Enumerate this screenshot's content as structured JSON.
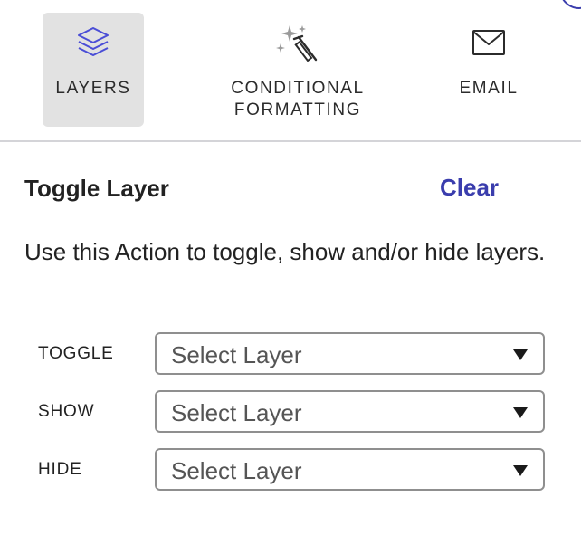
{
  "tabs": [
    {
      "label": "LAYERS",
      "icon": "layers-icon",
      "active": true
    },
    {
      "label_line1": "CONDITIONAL",
      "label_line2": "FORMATTING",
      "icon": "magic-wand-sparkles-icon",
      "active": false
    },
    {
      "label": "EMAIL",
      "icon": "envelope-icon",
      "active": false
    }
  ],
  "panel": {
    "title": "Toggle Layer",
    "clear_label": "Clear",
    "description": "Use this Action to toggle, show and/or hide layers."
  },
  "rows": [
    {
      "label": "TOGGLE",
      "select_value": "Select Layer"
    },
    {
      "label": "SHOW",
      "select_value": "Select Layer"
    },
    {
      "label": "HIDE",
      "select_value": "Select Layer"
    }
  ],
  "colors": {
    "accent": "#3a3dad",
    "active_tab_bg": "#e2e2e2",
    "divider": "#d4d4d8",
    "select_border": "#8f8f8f"
  }
}
